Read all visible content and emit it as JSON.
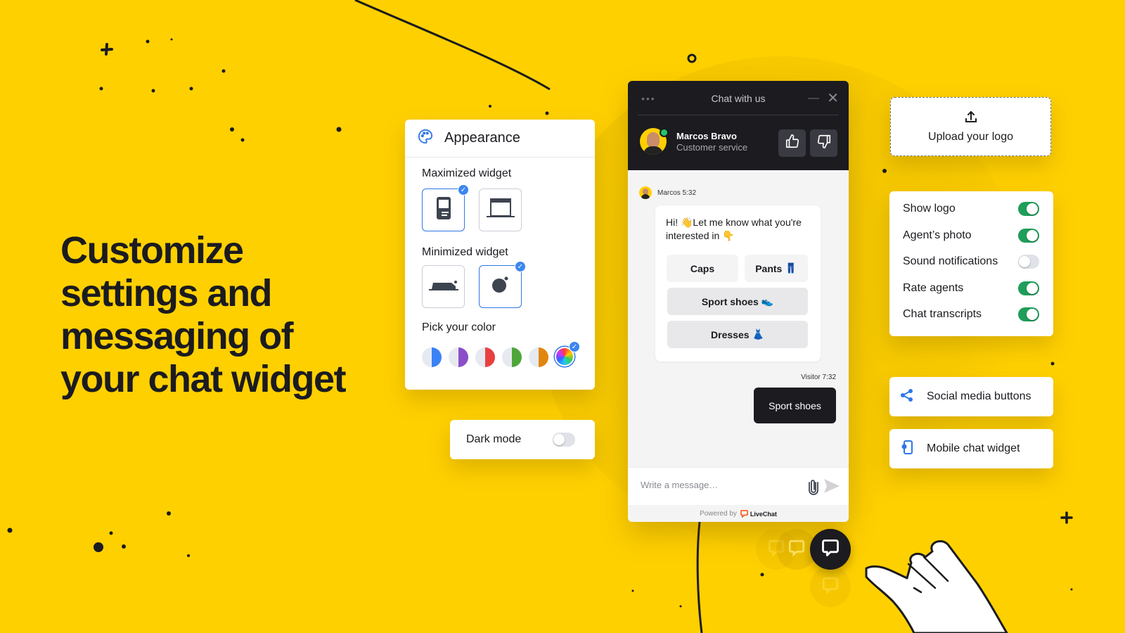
{
  "headline": {
    "lines": [
      "Customize",
      "settings and",
      "messaging of",
      "your chat widget"
    ]
  },
  "colors": {
    "background": "#FFD000",
    "dark": "#1b1b20",
    "accent_blue": "#2f76e8",
    "toggle_on": "#1f9e5a",
    "online": "#25c46a"
  },
  "appearance": {
    "icon": "palette-icon",
    "title": "Appearance",
    "maximized_label": "Maximized widget",
    "maximized_options": [
      {
        "name": "mobile-layout",
        "icon": "phone-widget-icon",
        "selected": true
      },
      {
        "name": "desktop-layout",
        "icon": "window-widget-icon",
        "selected": false
      }
    ],
    "minimized_label": "Minimized widget",
    "minimized_options": [
      {
        "name": "bar",
        "icon": "bar-widget-icon",
        "selected": false
      },
      {
        "name": "bubble",
        "icon": "bubble-widget-icon",
        "selected": true
      }
    ],
    "color_label": "Pick your color",
    "color_options": [
      {
        "name": "blue",
        "hex": "#3b82f6",
        "selected": false
      },
      {
        "name": "purple",
        "hex": "#8a4fc8",
        "selected": false
      },
      {
        "name": "red",
        "hex": "#e84040",
        "selected": false
      },
      {
        "name": "green",
        "hex": "#4ea63a",
        "selected": false
      },
      {
        "name": "orange",
        "hex": "#e0860f",
        "selected": false
      },
      {
        "name": "custom",
        "hex": "rainbow",
        "selected": true
      }
    ],
    "check_glyph": "✓"
  },
  "dark_mode": {
    "label": "Dark mode",
    "enabled": false
  },
  "chat": {
    "menu_glyph": "•••",
    "title": "Chat with us",
    "minimize_glyph": "—",
    "close_glyph": "✕",
    "agent": {
      "name": "Marcos Bravo",
      "role": "Customer service",
      "status": "online"
    },
    "rate_buttons": [
      {
        "name": "thumbs-up",
        "icon": "thumbs-up-icon"
      },
      {
        "name": "thumbs-down",
        "icon": "thumbs-down-icon"
      }
    ],
    "agent_message": {
      "meta": "Marcos 5:32",
      "text": "Hi! 👋Let me know what you're interested in 👇",
      "quick_replies": [
        {
          "label": "Caps",
          "emoji": ""
        },
        {
          "label": "Pants",
          "emoji": "👖"
        },
        {
          "label": "Sport shoes",
          "emoji": "👟"
        },
        {
          "label": "Dresses",
          "emoji": "👗"
        }
      ]
    },
    "visitor_message": {
      "meta": "Visitor 7:32",
      "text": "Sport shoes"
    },
    "composer": {
      "placeholder": "Write a message…",
      "value": ""
    },
    "powered_by": "Powered by",
    "brand": "LiveChat"
  },
  "upload": {
    "icon": "upload-icon",
    "label": "Upload your  logo"
  },
  "settings": [
    {
      "label": "Show logo",
      "enabled": true
    },
    {
      "label": "Agent’s photo",
      "enabled": true
    },
    {
      "label": "Sound notifications",
      "enabled": false
    },
    {
      "label": "Rate agents",
      "enabled": true
    },
    {
      "label": "Chat transcripts",
      "enabled": true
    }
  ],
  "features": [
    {
      "label": "Social media buttons",
      "icon": "share-icon"
    },
    {
      "label": "Mobile chat widget",
      "icon": "mobile-settings-icon"
    }
  ]
}
